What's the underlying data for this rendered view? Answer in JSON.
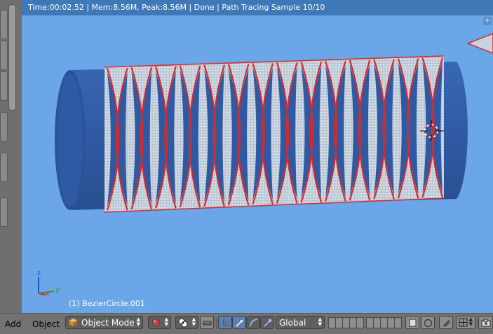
{
  "status": {
    "text": "Time:00:02.52 | Mem:8.56M, Peak:8.56M | Done | Path Tracing Sample 10/10"
  },
  "viewport": {
    "object_label": "(1) BezierCircle.001",
    "axes": {
      "z": "z",
      "y": "y",
      "x": "x"
    },
    "corner_button": "+"
  },
  "header": {
    "menu": {
      "add": "Add",
      "object": "Object"
    },
    "mode": "Object Mode",
    "orientation": "Global"
  },
  "icons": {
    "mode": "cube-icon",
    "shading": "sphere-shading-icon",
    "pivot": "pivot-point-icon",
    "manipulator": "manipulator-toggle-icon",
    "translate": "translate-arrow-icon",
    "rotate": "rotate-arc-icon",
    "scale": "scale-icon",
    "layers": "layer-grid-icon",
    "lock": "lock-icon",
    "render": "camera-render-icon"
  },
  "colors": {
    "viewport_bg": "#6aa6e8",
    "status_bg": "#3f78b6",
    "tube_blue": "#2f5aa3",
    "wrap_stripe": "#d42b2b",
    "wrap_fabric": "#c8d2de"
  }
}
